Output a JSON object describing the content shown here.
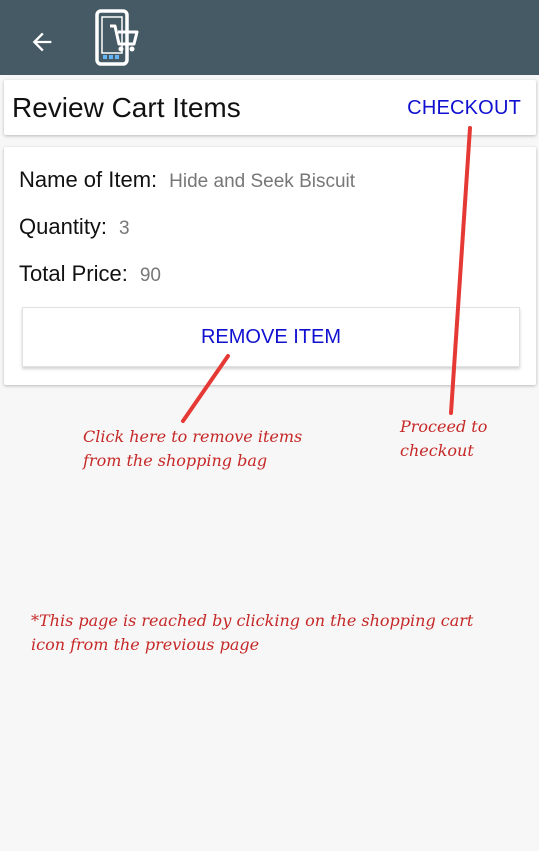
{
  "app": {
    "back_icon": "arrow-left-icon",
    "logo_icon": "phone-cart-icon"
  },
  "header": {
    "title": "Review Cart Items",
    "checkout_label": "CHECKOUT"
  },
  "cart_item": {
    "name_label": "Name of Item:",
    "name_value": "Hide and Seek Biscuit",
    "quantity_label": "Quantity:",
    "quantity_value": "3",
    "total_price_label": "Total Price:",
    "total_price_value": "90",
    "remove_label": "REMOVE ITEM"
  },
  "annotations": {
    "remove_note_line1": "Click here to remove items",
    "remove_note_line2": "from the shopping bag",
    "checkout_note_line1": "Proceed to",
    "checkout_note_line2": "checkout",
    "footer_note_line1": "*This page is reached by clicking on the shopping cart",
    "footer_note_line2": "icon from the previous page"
  },
  "colors": {
    "appbar": "#455a64",
    "accent": "#1010d0",
    "annotation": "#c62828",
    "background": "#f7f7f7"
  }
}
